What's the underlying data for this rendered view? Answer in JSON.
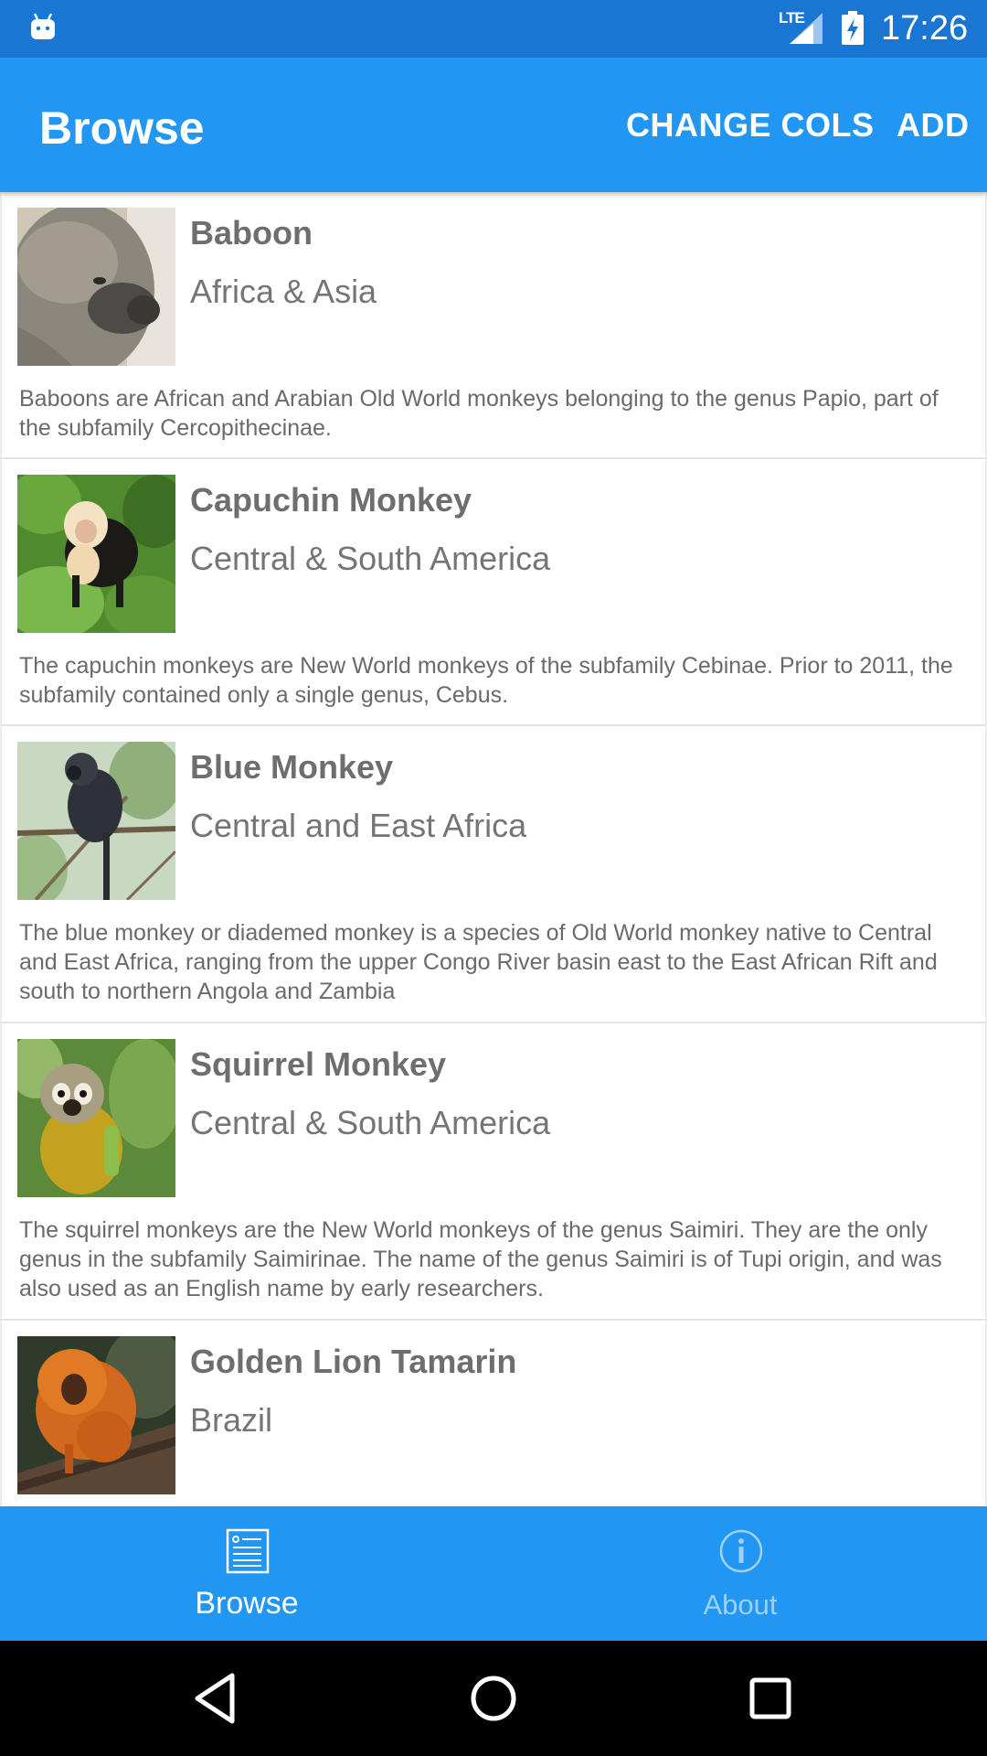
{
  "status_bar": {
    "network": "LTE",
    "time": "17:26"
  },
  "app_bar": {
    "title": "Browse",
    "change_cols_label": "CHANGE COLS",
    "add_label": "ADD"
  },
  "items": [
    {
      "name": "Baboon",
      "region": "Africa & Asia",
      "description": "Baboons are African and Arabian Old World monkeys belonging to the genus Papio, part of the subfamily Cercopithecinae."
    },
    {
      "name": "Capuchin Monkey",
      "region": "Central & South America",
      "description": "The capuchin monkeys are New World monkeys of the subfamily Cebinae. Prior to 2011, the subfamily contained only a single genus, Cebus."
    },
    {
      "name": "Blue Monkey",
      "region": "Central and East Africa",
      "description": "The blue monkey or diademed monkey is a species of Old World monkey native to Central and East Africa, ranging from the upper Congo River basin east to the East African Rift and south to northern Angola and Zambia"
    },
    {
      "name": "Squirrel Monkey",
      "region": "Central & South America",
      "description": "The squirrel monkeys are the New World monkeys of the genus Saimiri. They are the only genus in the subfamily Saimirinae. The name of the genus Saimiri is of Tupi origin, and was also used as an English name by early researchers."
    },
    {
      "name": "Golden Lion Tamarin",
      "region": "Brazil",
      "description": ""
    }
  ],
  "bottom_nav": {
    "tabs": [
      {
        "label": "Browse",
        "icon": "browse-list-icon",
        "selected": true
      },
      {
        "label": "About",
        "icon": "info-icon",
        "selected": false
      }
    ]
  },
  "colors": {
    "status_bar": "#1976d2",
    "primary": "#2196f3",
    "inactive_tab": "#9fd0fa"
  }
}
